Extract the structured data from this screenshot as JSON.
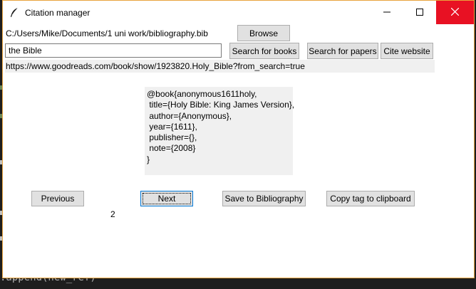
{
  "window": {
    "title": "Citation manager"
  },
  "icons": {
    "app": "feather-quill-icon",
    "minimize": "minimize-icon",
    "maximize": "maximize-icon",
    "close": "close-icon"
  },
  "file": {
    "path": "C:/Users/Mike/Documents/1 uni work/bibliography.bib",
    "browse_label": "Browse"
  },
  "search": {
    "value": "the Bible",
    "books_label": "Search for books",
    "papers_label": "Search for papers",
    "website_label": "Cite website"
  },
  "result": {
    "url": "https://www.goodreads.com/book/show/1923820.Holy_Bible?from_search=true",
    "bibtex": "@book{anonymous1611holy,\n title={Holy Bible: King James Version},\n author={Anonymous},\n year={1611},\n publisher={},\n note={2008}\n}"
  },
  "nav": {
    "previous_label": "Previous",
    "next_label": "Next",
    "save_label": "Save to Bibliography",
    "copy_label": "Copy tag to clipboard",
    "page_number": "2"
  },
  "background": {
    "code_fragment": ".append(new_ref)"
  },
  "colors": {
    "close_button": "#e81123",
    "window_border": "#e8a33d",
    "focus_border": "#0078d7",
    "button_face": "#e1e1e1",
    "panel_bg": "#f0f0f0"
  }
}
